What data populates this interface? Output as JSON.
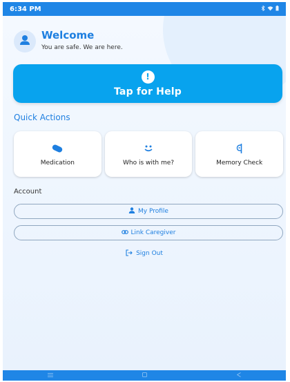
{
  "status_bar": {
    "time": "6:34 PM"
  },
  "welcome": {
    "title": "Welcome",
    "subtitle": "You are safe. We are here."
  },
  "help": {
    "alert_symbol": "!",
    "label": "Tap for Help"
  },
  "quick_actions": {
    "title": "Quick Actions",
    "items": [
      {
        "label": "Medication",
        "icon": "pill-icon"
      },
      {
        "label": "Who is with me?",
        "icon": "smile-icon"
      },
      {
        "label": "Memory Check",
        "icon": "brain-icon"
      }
    ]
  },
  "account": {
    "title": "Account",
    "profile_label": "My Profile",
    "link_label": "Link Caregiver",
    "signout_label": "Sign Out"
  },
  "colors": {
    "primary": "#1e7fe0",
    "status_bar": "#1f86e6",
    "help_button": "#08a3ee"
  }
}
